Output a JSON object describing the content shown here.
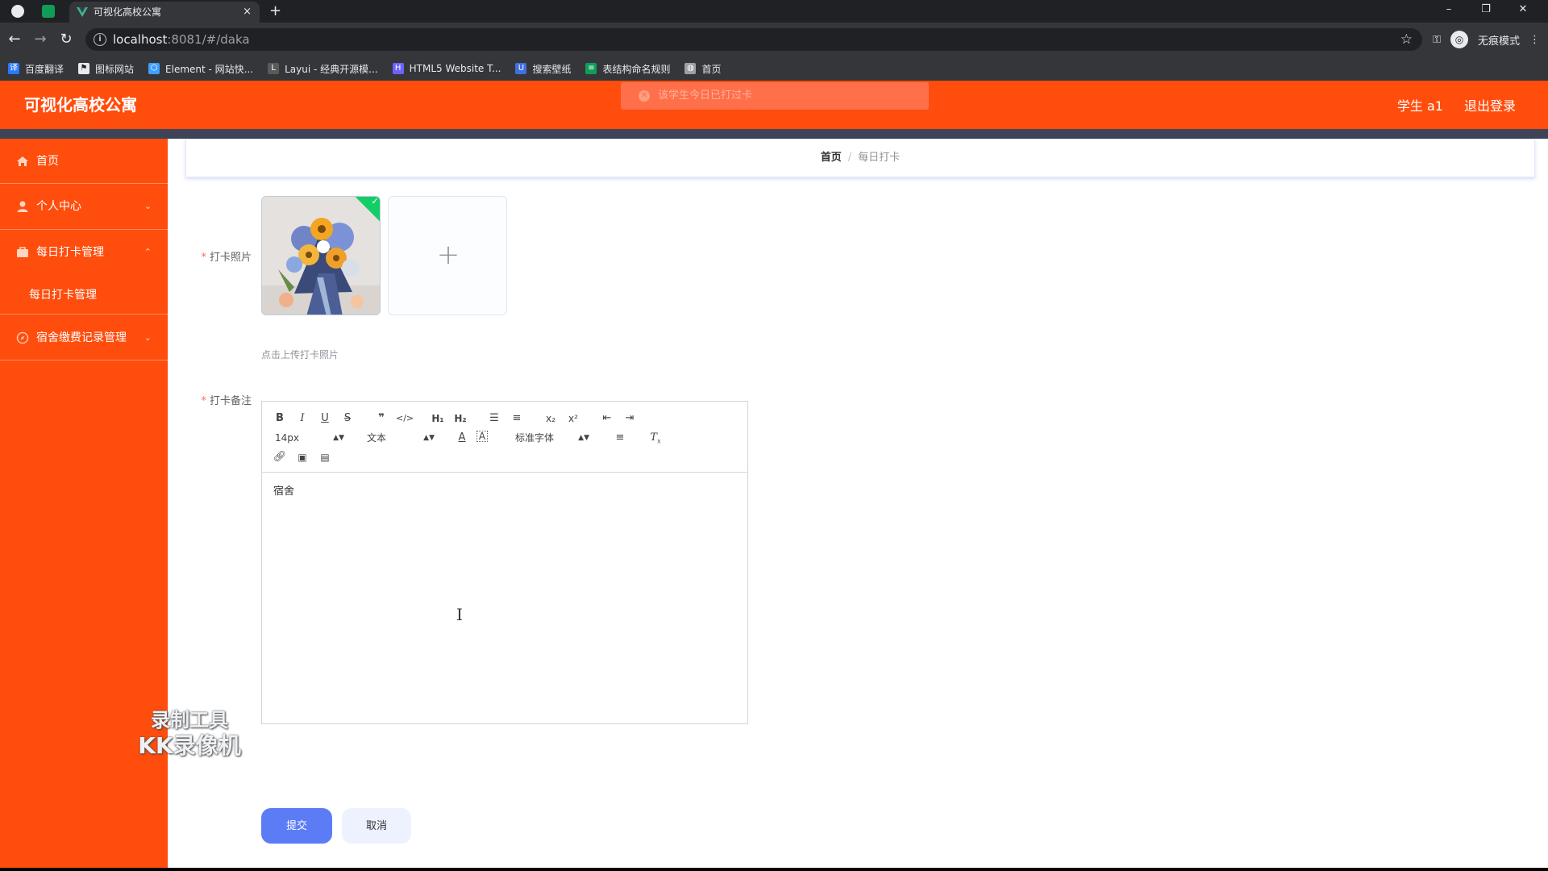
{
  "browser": {
    "tab_title": "可视化高校公寓",
    "tab_close": "×",
    "new_tab": "+",
    "url_host": "localhost",
    "url_rest": ":8081/#/daka",
    "profile_label": "无痕模式",
    "window_controls": {
      "minimize": "–",
      "restore": "❐",
      "close": "✕"
    },
    "bookmarks": [
      {
        "label": "百度翻译",
        "color": "#2979ff",
        "glyph": "译"
      },
      {
        "label": "图标网站",
        "color": "#e8eaed",
        "glyph": "⚑"
      },
      {
        "label": "Element - 网站快...",
        "color": "#409eff",
        "glyph": "⬡"
      },
      {
        "label": "Layui - 经典开源模...",
        "color": "#5a5a5a",
        "glyph": "L"
      },
      {
        "label": "HTML5 Website T...",
        "color": "#6c63ff",
        "glyph": "H"
      },
      {
        "label": "搜索壁纸",
        "color": "#3f6fe0",
        "glyph": "U"
      },
      {
        "label": "表结构命名规则",
        "color": "#0f9d58",
        "glyph": "≡"
      },
      {
        "label": "首页",
        "color": "#9aa0a6",
        "glyph": "◍"
      }
    ]
  },
  "header": {
    "title": "可视化高校公寓",
    "user": "学生 a1",
    "logout": "退出登录"
  },
  "toast": {
    "message": "该学生今日已打过卡"
  },
  "sidebar": {
    "items": [
      {
        "label": "首页",
        "icon": "home-icon"
      },
      {
        "label": "个人中心",
        "icon": "user-icon",
        "arrow": "⌄"
      },
      {
        "label": "每日打卡管理",
        "icon": "briefcase-icon",
        "arrow": "⌃"
      },
      {
        "label": "每日打卡管理",
        "sub": true
      },
      {
        "label": "宿舍缴费记录管理",
        "icon": "compass-icon",
        "arrow": "⌄"
      }
    ]
  },
  "watermark": {
    "line1": "录制工具",
    "line2": "KK录像机"
  },
  "breadcrumb": {
    "home": "首页",
    "separator": "/",
    "current": "每日打卡"
  },
  "form": {
    "photo_label": "打卡照片",
    "photo_tip": "点击上传打卡照片",
    "remark_label": "打卡备注",
    "required_mark": "*",
    "remark_content": "宿舍",
    "submit": "提交",
    "cancel": "取消"
  },
  "editor": {
    "font_size": "14px",
    "header_select": "文本",
    "font_family": "标准字体"
  },
  "colors": {
    "brand": "#ff4d0d",
    "primary_button": "#5c7cf6",
    "success": "#13ce66"
  }
}
